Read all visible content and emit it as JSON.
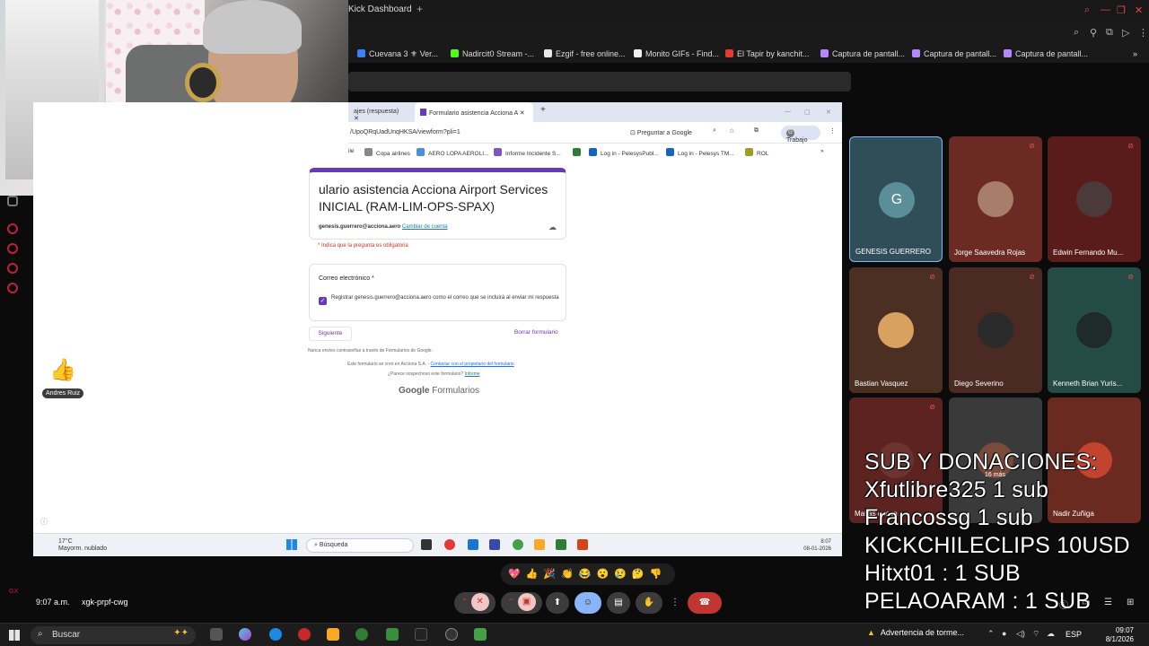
{
  "outer_browser": {
    "tab_title": "Kick Dashboard",
    "new_tab": "+",
    "bookmarks": [
      {
        "label": "Cuevana 3 ⚜ Ver...",
        "color": "#3b82f6"
      },
      {
        "label": "Nadircit0 Stream -...",
        "color": "#53fc18"
      },
      {
        "label": "Ezgif - free online...",
        "color": "#e8e8e8"
      },
      {
        "label": "Monito GIFs - Find...",
        "color": "#f0f0f0"
      },
      {
        "label": "El Tapir by kanchit...",
        "color": "#e53935"
      },
      {
        "label": "Captura de pantall...",
        "color": "#b388ff"
      },
      {
        "label": "Captura de pantall...",
        "color": "#b388ff"
      },
      {
        "label": "Captura de pantall...",
        "color": "#b388ff"
      }
    ],
    "more_bookmarks": "»"
  },
  "shared_screen": {
    "tabs": [
      {
        "label": "ajes (respuesta)",
        "active": false
      },
      {
        "label": "Formulario asistencia Acciona A",
        "active": true
      }
    ],
    "url": "/UpoQRqUadUnqHKSA/viewform?pli=1",
    "ask_google": "Preguntar a Google",
    "profile_label": "Trabajo",
    "profile_initial": "G",
    "bookmarks": [
      "Copa airlines",
      "AERO LOPA AEROLI...",
      "Informe Incidente S...",
      "Log in - PelesysPubl...",
      "Log in - Pelesys TM...",
      "ROL"
    ],
    "bookmark_first": "ile",
    "form": {
      "title": "ulario asistencia Acciona Airport Services INICIAL (RAM-LIM-OPS-SPAX)",
      "account_email": "genesis.guerrero@acciona.aero",
      "switch_account": "Cambiar de cuenta",
      "required_note": "* Indica que la pregunta es obligatoria",
      "field_label": "Correo electrónico *",
      "checkbox_text": "Registrar genesis.guerrero@acciona.aero como el correo que se incluirá al enviar mi respuesta",
      "next_button": "Siguiente",
      "clear_button": "Borrar formulario",
      "footer_password": "Nunca envíes contraseñas a través de Formularios de Google.",
      "footer_created": "Este formulario se creó en Acciona S.A. -",
      "footer_contact": "Contactar con el propietario del formulario",
      "footer_suspicious": "¿Parece sospechoso este formulario?",
      "footer_report": "Informe",
      "brand_google": "Google",
      "brand_forms": "Formularios"
    },
    "reaction": {
      "emoji": "👍",
      "name": "Andres Ruiz"
    },
    "taskbar": {
      "temp": "17°C",
      "weather": "Mayorm. nublado",
      "search": "Búsqueda",
      "time": "8:07",
      "date": "08-01-2026"
    }
  },
  "participants": [
    {
      "name": "GENESIS GUERRERO",
      "initial": "G",
      "bg": "#2f4e57",
      "avatar_bg": "#5a8e99",
      "muted": false,
      "highlight": true
    },
    {
      "name": "Jorge Saavedra Rojas",
      "initial": "",
      "bg": "#6b2a24",
      "avatar_bg": "#a87d6a",
      "muted": true,
      "highlight": false
    },
    {
      "name": "Edwin Fernando Mu...",
      "initial": "",
      "bg": "#5a1c1a",
      "avatar_bg": "#4a3a3a",
      "muted": true,
      "highlight": false
    },
    {
      "name": "Bastian Vasquez",
      "initial": "",
      "bg": "#4b2f22",
      "avatar_bg": "#d7a15f",
      "muted": true,
      "highlight": false
    },
    {
      "name": "Diego Severino",
      "initial": "",
      "bg": "#4a2a22",
      "avatar_bg": "#2b2b2b",
      "muted": true,
      "highlight": false
    },
    {
      "name": "Kenneth Brian Yuris...",
      "initial": "",
      "bg": "#244b44",
      "avatar_bg": "#1f2a2a",
      "muted": true,
      "highlight": false
    },
    {
      "name": "Matias opazo",
      "initial": "",
      "bg": "#5c2320",
      "avatar_bg": "#6c3330",
      "muted": true,
      "highlight": false
    },
    {
      "name": "",
      "initial": "",
      "bg": "#3a3a3a",
      "avatar_bg": "#7a4a3a",
      "muted": false,
      "highlight": false
    },
    {
      "name": "Nadir Zuñiga",
      "initial": "",
      "bg": "#6b2a20",
      "avatar_bg": "#c2442e",
      "muted": false,
      "highlight": false
    }
  ],
  "more_participants": "16 más",
  "overlay": {
    "lines": [
      "SUB Y DONACIONES:",
      "Xfutlibre325 1 sub",
      "Francossg 1 sub",
      "KICKCHILECLIPS 10USD",
      "Hitxt01 : 1 SUB",
      "PELAOARAM : 1 SUB"
    ]
  },
  "meet": {
    "time": "9:07 a.m.",
    "separator": "|",
    "code": "xgk-prpf-cwg",
    "emojis": "💖👍🎉👏😂😮😢🤔👎"
  },
  "taskbar": {
    "search": "Buscar",
    "warning": "Advertencia de torme...",
    "lang": "ESP",
    "time": "09:07",
    "date": "8/1/2026"
  }
}
